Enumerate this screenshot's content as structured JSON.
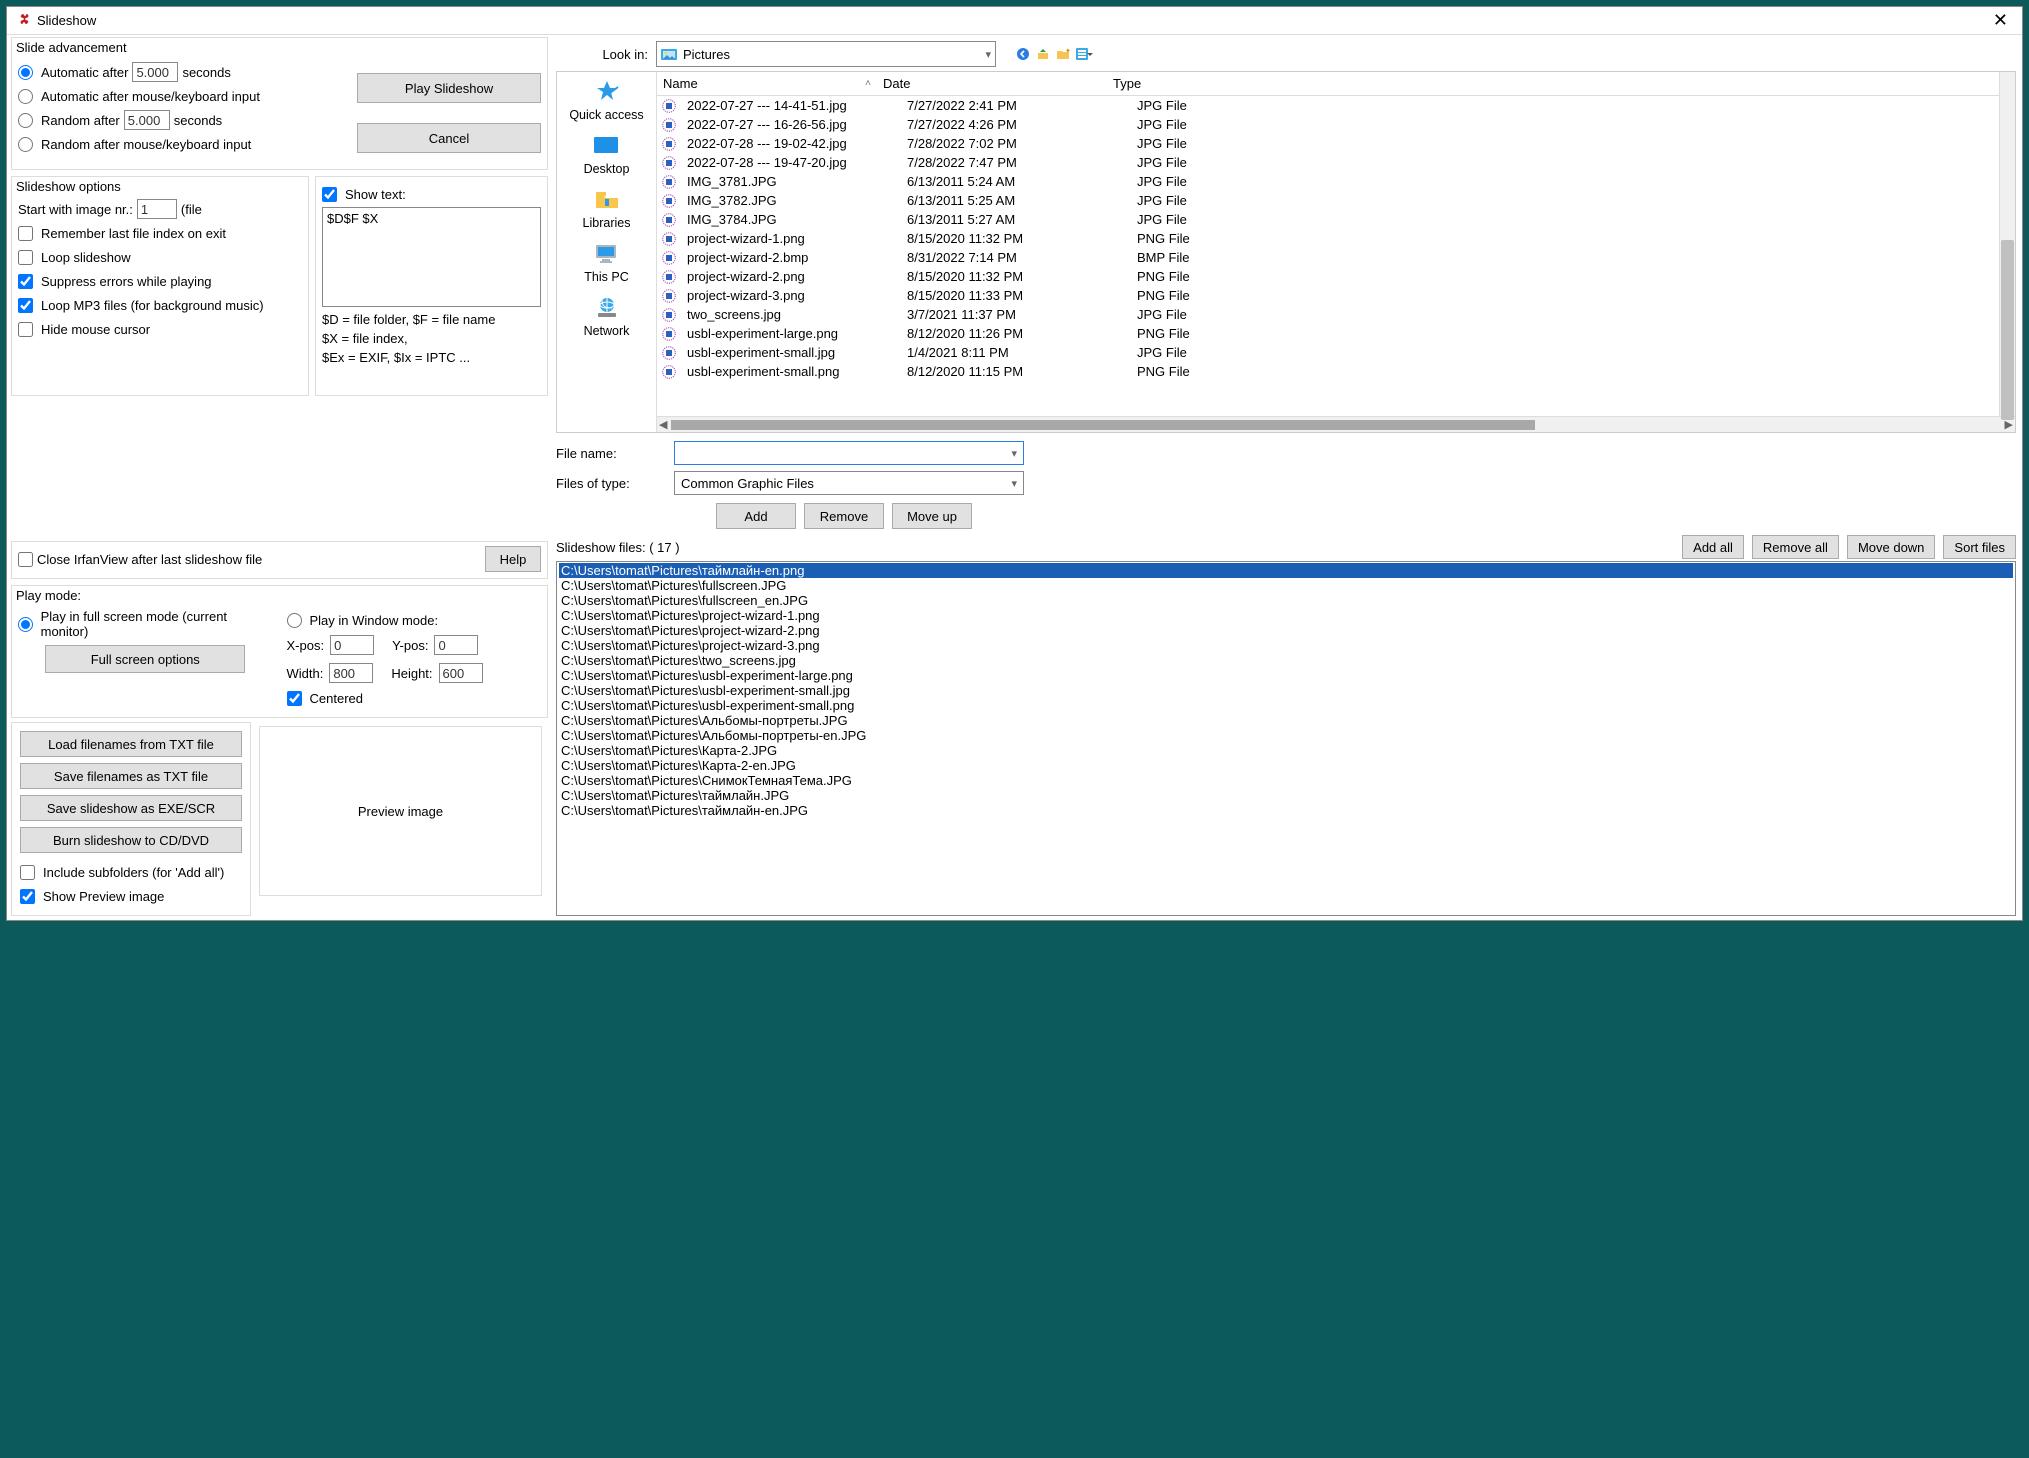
{
  "window": {
    "title": "Slideshow"
  },
  "adv": {
    "group": "Slide advancement",
    "auto_after": "Automatic after",
    "auto_after_val": "5.000",
    "seconds": "seconds",
    "auto_mouse": "Automatic after mouse/keyboard input",
    "random_after": "Random   after",
    "random_after_val": "5.000",
    "random_mouse": "Random   after mouse/keyboard input",
    "play": "Play Slideshow",
    "cancel": "Cancel"
  },
  "opts": {
    "group": "Slideshow options",
    "start_with": "Start with image nr.:",
    "start_val": "1",
    "file_suffix": "(file",
    "remember": "Remember last file index on exit",
    "loop": "Loop slideshow",
    "suppress": "Suppress errors while playing",
    "loopmp3": "Loop MP3 files (for background music)",
    "hide_cursor": "Hide mouse cursor",
    "show_text": "Show text:",
    "text_val": "$D$F $X",
    "legend1": "$D = file folder, $F = file name",
    "legend2": "$X = file index,",
    "legend3": "$Ex = EXIF, $Ix = IPTC ..."
  },
  "close_after": "Close IrfanView after last slideshow file",
  "help": "Help",
  "playmode": {
    "label": "Play mode:",
    "full": "Play in full screen mode (current monitor)",
    "fullopt": "Full screen options",
    "win": "Play in Window mode:",
    "xpos": "X-pos:",
    "xpos_v": "0",
    "ypos": "Y-pos:",
    "ypos_v": "0",
    "width": "Width:",
    "width_v": "800",
    "height": "Height:",
    "height_v": "600",
    "centered": "Centered"
  },
  "bl": {
    "load": "Load filenames from TXT file",
    "save": "Save filenames as TXT file",
    "saveexe": "Save slideshow as  EXE/SCR",
    "burn": "Burn slideshow to CD/DVD",
    "incl": "Include subfolders (for 'Add all')",
    "showprev": "Show Preview image",
    "preview": "Preview image"
  },
  "browser": {
    "lookin": "Look in:",
    "folder": "Pictures",
    "cols": {
      "name": "Name",
      "date": "Date",
      "type": "Type"
    },
    "places": [
      "Quick access",
      "Desktop",
      "Libraries",
      "This PC",
      "Network"
    ],
    "files": [
      {
        "name": "2022-07-27 --- 14-41-51.jpg",
        "date": "7/27/2022 2:41 PM",
        "type": "JPG File"
      },
      {
        "name": "2022-07-27 --- 16-26-56.jpg",
        "date": "7/27/2022 4:26 PM",
        "type": "JPG File"
      },
      {
        "name": "2022-07-28 --- 19-02-42.jpg",
        "date": "7/28/2022 7:02 PM",
        "type": "JPG File"
      },
      {
        "name": "2022-07-28 --- 19-47-20.jpg",
        "date": "7/28/2022 7:47 PM",
        "type": "JPG File"
      },
      {
        "name": "IMG_3781.JPG",
        "date": "6/13/2011 5:24 AM",
        "type": "JPG File"
      },
      {
        "name": "IMG_3782.JPG",
        "date": "6/13/2011 5:25 AM",
        "type": "JPG File"
      },
      {
        "name": "IMG_3784.JPG",
        "date": "6/13/2011 5:27 AM",
        "type": "JPG File"
      },
      {
        "name": "project-wizard-1.png",
        "date": "8/15/2020 11:32 PM",
        "type": "PNG File"
      },
      {
        "name": "project-wizard-2.bmp",
        "date": "8/31/2022 7:14 PM",
        "type": "BMP File"
      },
      {
        "name": "project-wizard-2.png",
        "date": "8/15/2020 11:32 PM",
        "type": "PNG File"
      },
      {
        "name": "project-wizard-3.png",
        "date": "8/15/2020 11:33 PM",
        "type": "PNG File"
      },
      {
        "name": "two_screens.jpg",
        "date": "3/7/2021 11:37 PM",
        "type": "JPG File"
      },
      {
        "name": "usbl-experiment-large.png",
        "date": "8/12/2020 11:26 PM",
        "type": "PNG File"
      },
      {
        "name": "usbl-experiment-small.jpg",
        "date": "1/4/2021 8:11 PM",
        "type": "JPG File"
      },
      {
        "name": "usbl-experiment-small.png",
        "date": "8/12/2020 11:15 PM",
        "type": "PNG File"
      }
    ],
    "filename_lbl": "File name:",
    "filename_val": "",
    "filetype_lbl": "Files of type:",
    "filetype_val": "Common Graphic Files"
  },
  "sf": {
    "add": "Add",
    "remove": "Remove",
    "moveup": "Move up",
    "addall": "Add all",
    "removeall": "Remove all",
    "movedown": "Move down",
    "sort": "Sort files",
    "label": "Slideshow files:  ( 17 )",
    "items": [
      "C:\\Users\\tomat\\Pictures\\таймлайн-en.png",
      "C:\\Users\\tomat\\Pictures\\fullscreen.JPG",
      "C:\\Users\\tomat\\Pictures\\fullscreen_en.JPG",
      "C:\\Users\\tomat\\Pictures\\project-wizard-1.png",
      "C:\\Users\\tomat\\Pictures\\project-wizard-2.png",
      "C:\\Users\\tomat\\Pictures\\project-wizard-3.png",
      "C:\\Users\\tomat\\Pictures\\two_screens.jpg",
      "C:\\Users\\tomat\\Pictures\\usbl-experiment-large.png",
      "C:\\Users\\tomat\\Pictures\\usbl-experiment-small.jpg",
      "C:\\Users\\tomat\\Pictures\\usbl-experiment-small.png",
      "C:\\Users\\tomat\\Pictures\\Альбомы-портреты.JPG",
      "C:\\Users\\tomat\\Pictures\\Альбомы-портреты-en.JPG",
      "C:\\Users\\tomat\\Pictures\\Карта-2.JPG",
      "C:\\Users\\tomat\\Pictures\\Карта-2-en.JPG",
      "C:\\Users\\tomat\\Pictures\\СнимокТемнаяТема.JPG",
      "C:\\Users\\tomat\\Pictures\\таймлайн.JPG",
      "C:\\Users\\tomat\\Pictures\\таймлайн-en.JPG"
    ]
  }
}
